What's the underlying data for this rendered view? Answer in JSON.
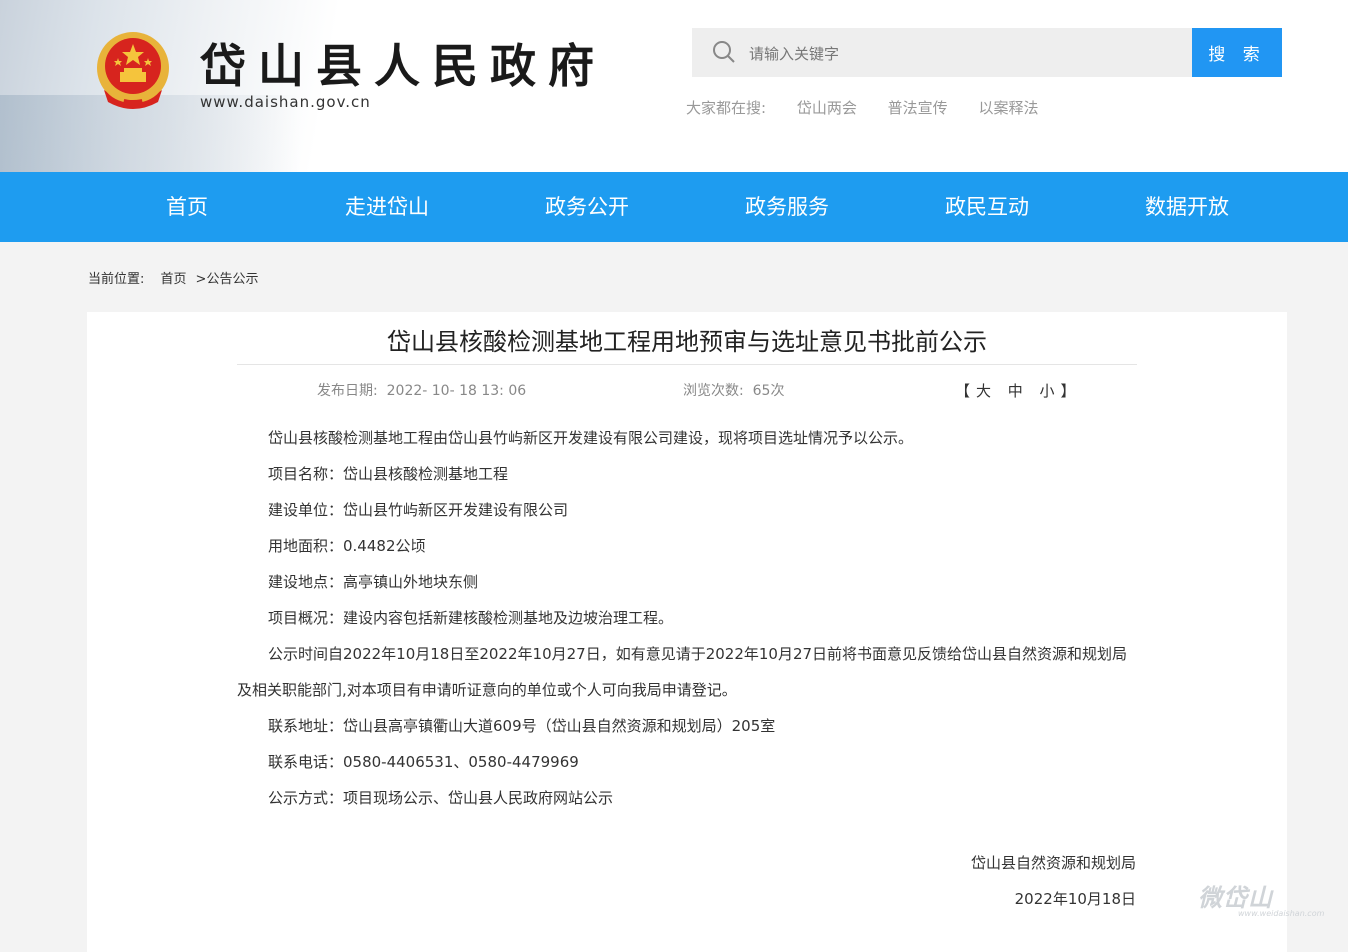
{
  "header": {
    "site_title": "岱山县人民政府",
    "site_url": "www.daishan.gov.cn",
    "search_placeholder": "请输入关键字",
    "search_button": "搜 索",
    "hot_label": "大家都在搜:",
    "hot_items": [
      "岱山两会",
      "普法宣传",
      "以案释法"
    ]
  },
  "nav": {
    "items": [
      "首页",
      "走进岱山",
      "政务公开",
      "政务服务",
      "政民互动",
      "数据开放"
    ]
  },
  "breadcrumb": {
    "label": "当前位置:",
    "home": "首页",
    "current": ">公告公示"
  },
  "article": {
    "title": "岱山县核酸检测基地工程用地预审与选址意见书批前公示",
    "publish_label": "发布日期:",
    "publish_date": "2022- 10- 18 13: 06",
    "views_label": "浏览次数:",
    "views": "65次",
    "font_size_control": "【大 中 小】",
    "paragraphs": [
      "岱山县核酸检测基地工程由岱山县竹屿新区开发建设有限公司建设，现将项目选址情况予以公示。",
      "项目名称：岱山县核酸检测基地工程",
      "建设单位：岱山县竹屿新区开发建设有限公司",
      "用地面积：0.4482公顷",
      "建设地点：高亭镇山外地块东侧",
      "项目概况：建设内容包括新建核酸检测基地及边坡治理工程。",
      "公示时间自2022年10月18日至2022年10月27日，如有意见请于2022年10月27日前将书面意见反馈给岱山县自然资源和规划局及相关职能部门,对本项目有申请听证意向的单位或个人可向我局申请登记。",
      "联系地址：岱山县高亭镇衢山大道609号（岱山县自然资源和规划局）205室",
      "联系电话：0580-4406531、0580-4479969",
      "公示方式：项目现场公示、岱山县人民政府网站公示"
    ],
    "signer": "岱山县自然资源和规划局",
    "sign_date": "2022年10月18日"
  },
  "watermark": {
    "text": "微岱山",
    "url": "www.weidaishan.com"
  },
  "colors": {
    "nav_blue": "#1e9cf0",
    "search_button_blue": "#2196f3"
  }
}
